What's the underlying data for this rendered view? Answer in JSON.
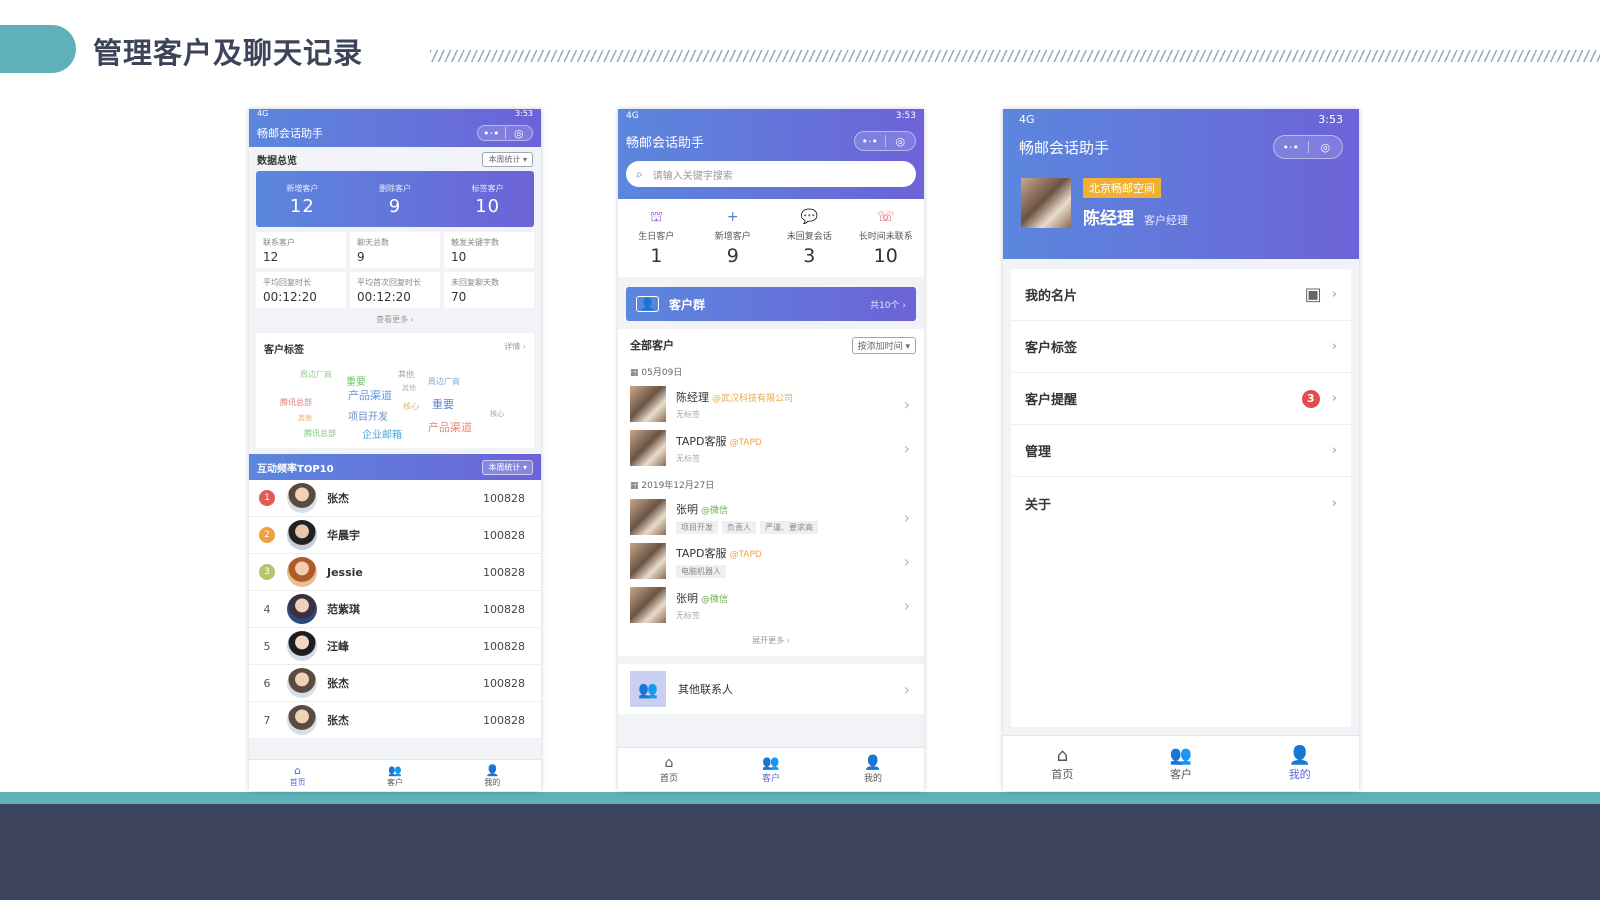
{
  "slide": {
    "title": "管理客户及聊天记录"
  },
  "common": {
    "app_title": "畅邮会话助手",
    "time": "3:53",
    "signal": "4G",
    "capsule_more": "•·•",
    "capsule_close": "◎"
  },
  "phone1": {
    "overview_title": "数据总览",
    "period": "本周统计",
    "top_stats": [
      {
        "label": "新增客户",
        "value": "12"
      },
      {
        "label": "删除客户",
        "value": "9"
      },
      {
        "label": "标签客户",
        "value": "10"
      }
    ],
    "grid_stats": [
      {
        "label": "联系客户",
        "value": "12"
      },
      {
        "label": "聊天总数",
        "value": "9"
      },
      {
        "label": "触发关键字数",
        "value": "10"
      },
      {
        "label": "平均回复时长",
        "value": "00:12:20"
      },
      {
        "label": "平均首次回复时长",
        "value": "00:12:20"
      },
      {
        "label": "未回复聊天数",
        "value": "70"
      }
    ],
    "see_more": "查看更多 ›",
    "tags_title": "客户标签",
    "tags_detail": "详情 ›",
    "tag_words": [
      {
        "text": "周边厂商",
        "color": "#8fcf8f"
      },
      {
        "text": "重要",
        "color": "#6cc46c"
      },
      {
        "text": "其他",
        "color": "#9aa5b5"
      },
      {
        "text": "周边厂商",
        "color": "#7da7d8"
      },
      {
        "text": "产品渠道",
        "color": "#5a9ee0"
      },
      {
        "text": "其他",
        "color": "#b0b0b0"
      },
      {
        "text": "腾讯总部",
        "color": "#e07b7b"
      },
      {
        "text": "项目开发",
        "color": "#6a8fd0"
      },
      {
        "text": "核心",
        "color": "#e8b45a"
      },
      {
        "text": "重要",
        "color": "#5a86d6"
      },
      {
        "text": "其他",
        "color": "#e8b45a"
      },
      {
        "text": "核心",
        "color": "#a0a0a0"
      },
      {
        "text": "腾讯总部",
        "color": "#7cc47c"
      },
      {
        "text": "企业邮箱",
        "color": "#4aa6d8"
      },
      {
        "text": "产品渠道",
        "color": "#e88a7a"
      }
    ],
    "rank_title": "互动频率TOP10",
    "rank_period": "本周统计",
    "ranks": [
      {
        "rank": "1",
        "name": "张杰",
        "value": "100828",
        "color": "#e05a5a"
      },
      {
        "rank": "2",
        "name": "华晨宇",
        "value": "100828",
        "color": "#f0a040"
      },
      {
        "rank": "3",
        "name": "Jessie",
        "value": "100828",
        "color": "#b8c46a"
      },
      {
        "rank": "4",
        "name": "范紫琪",
        "value": "100828",
        "color": ""
      },
      {
        "rank": "5",
        "name": "汪峰",
        "value": "100828",
        "color": ""
      },
      {
        "rank": "6",
        "name": "张杰",
        "value": "100828",
        "color": ""
      },
      {
        "rank": "7",
        "name": "张杰",
        "value": "100828",
        "color": ""
      }
    ]
  },
  "phone2": {
    "search_placeholder": "请输入关键字搜索",
    "quick": [
      {
        "label": "生日客户",
        "value": "1",
        "icon": "cake-icon",
        "color": "#8a5bd8"
      },
      {
        "label": "新增客户",
        "value": "9",
        "icon": "plus-icon",
        "color": "#5a7bd8"
      },
      {
        "label": "未回复会话",
        "value": "3",
        "icon": "chat-icon",
        "color": "#4aa86a"
      },
      {
        "label": "长时间未联系",
        "value": "10",
        "icon": "missed-call-icon",
        "color": "#e05a5a"
      }
    ],
    "group_label": "客户群",
    "group_count": "共10个 ›",
    "all_customers": "全部客户",
    "sort": "按添加时间",
    "sections": [
      {
        "date": "05月09日",
        "customers": [
          {
            "name": "陈经理",
            "org": "@武汉科技有限公司",
            "tags": [],
            "notag": "无标签"
          },
          {
            "name": "TAPD客服",
            "org": "@TAPD",
            "tags": [],
            "notag": "无标签"
          }
        ]
      },
      {
        "date": "2019年12月27日",
        "customers": [
          {
            "name": "张明",
            "org": "@微信",
            "tags": [
              "项目开发",
              "负责人",
              "严谨、要求高"
            ],
            "notag": ""
          },
          {
            "name": "TAPD客服",
            "org": "@TAPD",
            "tags": [
              "电脑机器人"
            ],
            "notag": ""
          },
          {
            "name": "张明",
            "org": "@微信",
            "tags": [],
            "notag": "无标签"
          }
        ]
      }
    ],
    "expand": "展开更多 ›",
    "other_contacts": "其他联系人"
  },
  "phone3": {
    "company": "北京畅邮空间",
    "name": "陈经理",
    "role": "客户经理",
    "menu": [
      {
        "label": "我的名片",
        "badge": "",
        "qr": true
      },
      {
        "label": "客户标签",
        "badge": "",
        "qr": false
      },
      {
        "label": "客户提醒",
        "badge": "3",
        "qr": false
      },
      {
        "label": "管理",
        "badge": "",
        "qr": false
      },
      {
        "label": "关于",
        "badge": "",
        "qr": false
      }
    ]
  },
  "tabs": {
    "home": "首页",
    "customers": "客户",
    "mine": "我的"
  },
  "colors": {
    "accent": "#5a67d8",
    "teal": "#5fb0b8",
    "dark": "#3b445c"
  }
}
